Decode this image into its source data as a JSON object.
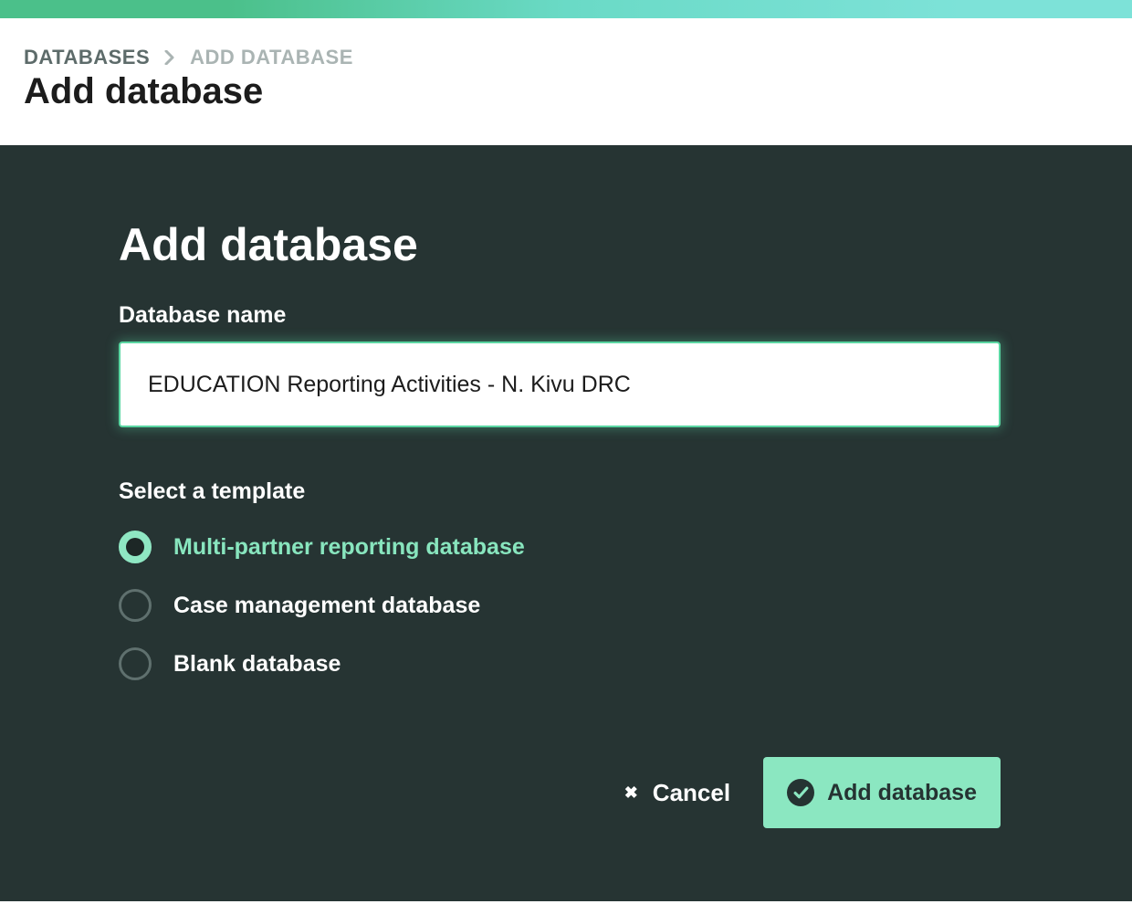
{
  "breadcrumb": {
    "items": [
      {
        "label": "DATABASES",
        "active": false
      },
      {
        "label": "ADD DATABASE",
        "active": true
      }
    ]
  },
  "header": {
    "title": "Add database"
  },
  "form": {
    "title": "Add database",
    "name_label": "Database name",
    "name_value": "EDUCATION Reporting Activities - N. Kivu DRC",
    "template_label": "Select a template",
    "templates": [
      {
        "label": "Multi-partner reporting database",
        "selected": true
      },
      {
        "label": "Case management database",
        "selected": false
      },
      {
        "label": "Blank database",
        "selected": false
      }
    ],
    "cancel_label": "Cancel",
    "submit_label": "Add database"
  },
  "colors": {
    "panel_bg": "#263433",
    "accent": "#8be7c1",
    "input_border": "#5ad6a2"
  }
}
